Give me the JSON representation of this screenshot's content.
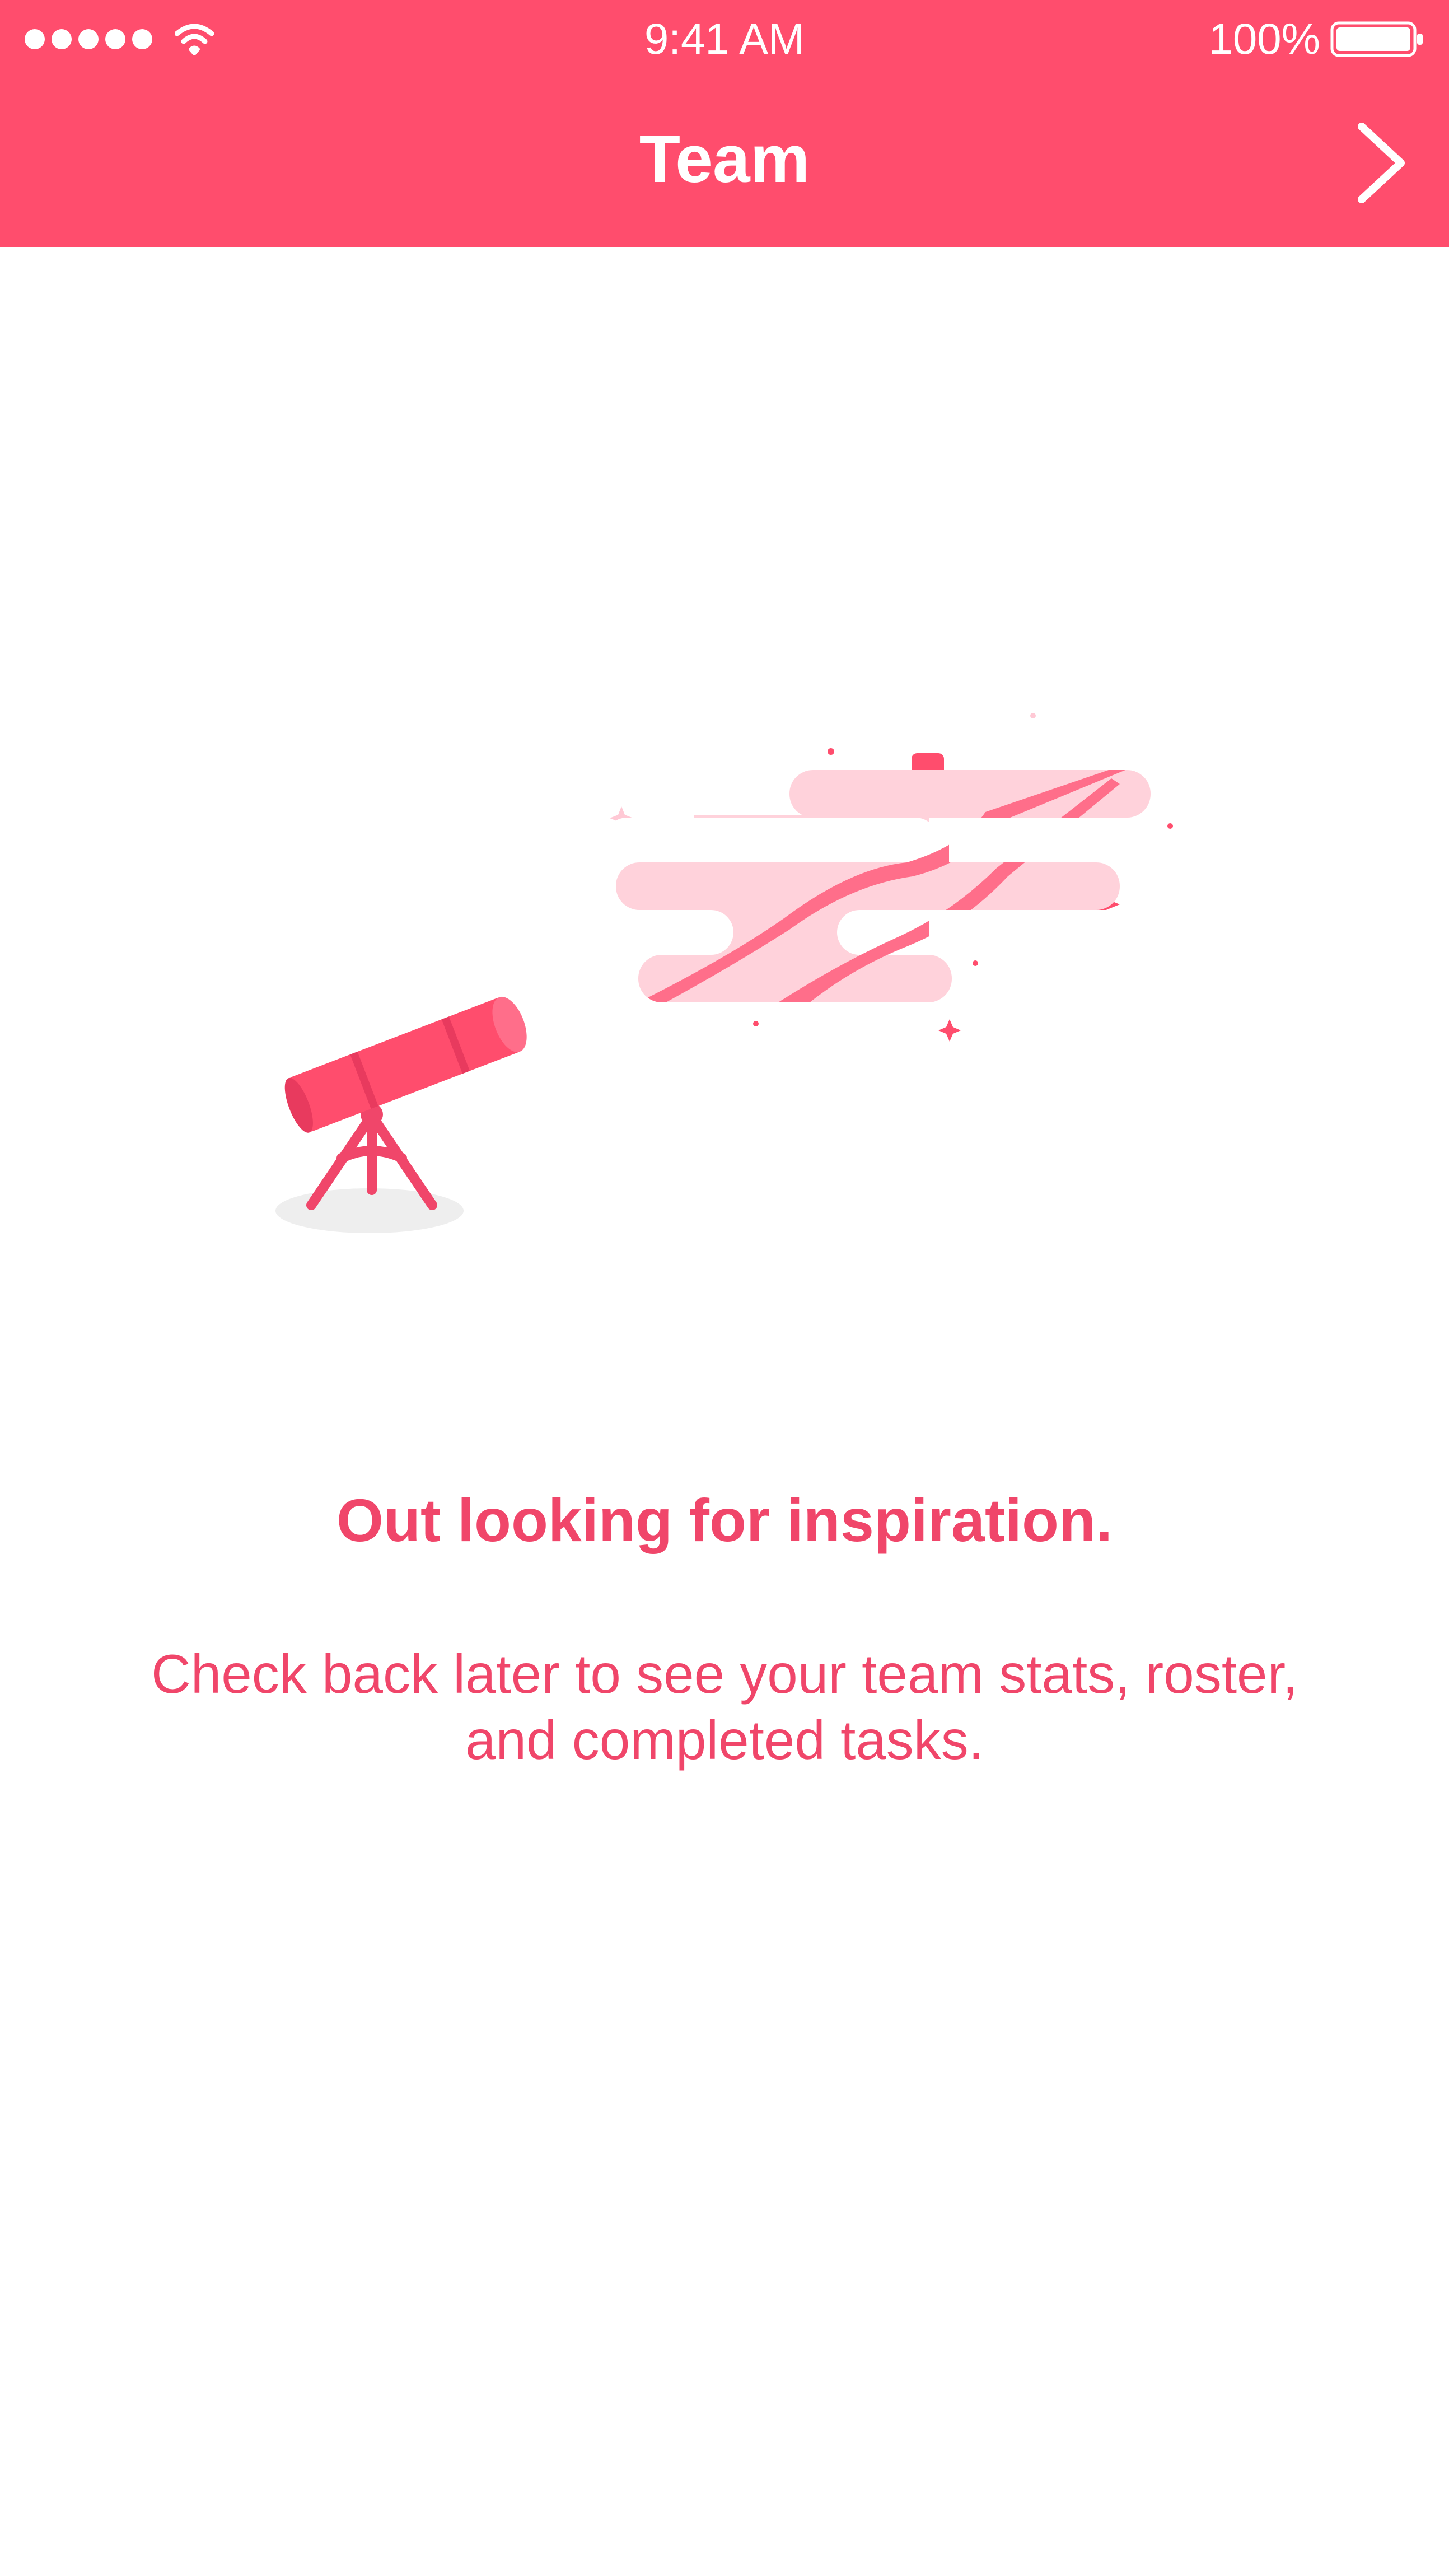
{
  "status_bar": {
    "time": "9:41 AM",
    "battery": "100%",
    "signal_icon": "cellular-signal-icon",
    "wifi_icon": "wifi-icon",
    "battery_icon": "battery-icon"
  },
  "nav": {
    "title": "Team",
    "next_icon": "chevron-right-icon"
  },
  "empty_state": {
    "illustration": "telescope-looking-at-clouds-illustration",
    "headline": "Out looking for inspiration.",
    "message": "Check back later to see your team stats, roster, and completed tasks."
  },
  "colors": {
    "accent": "#FF4D6D",
    "text_accent": "#F0466A",
    "cloud": "#FFD2DB",
    "background": "#FFFFFF"
  }
}
